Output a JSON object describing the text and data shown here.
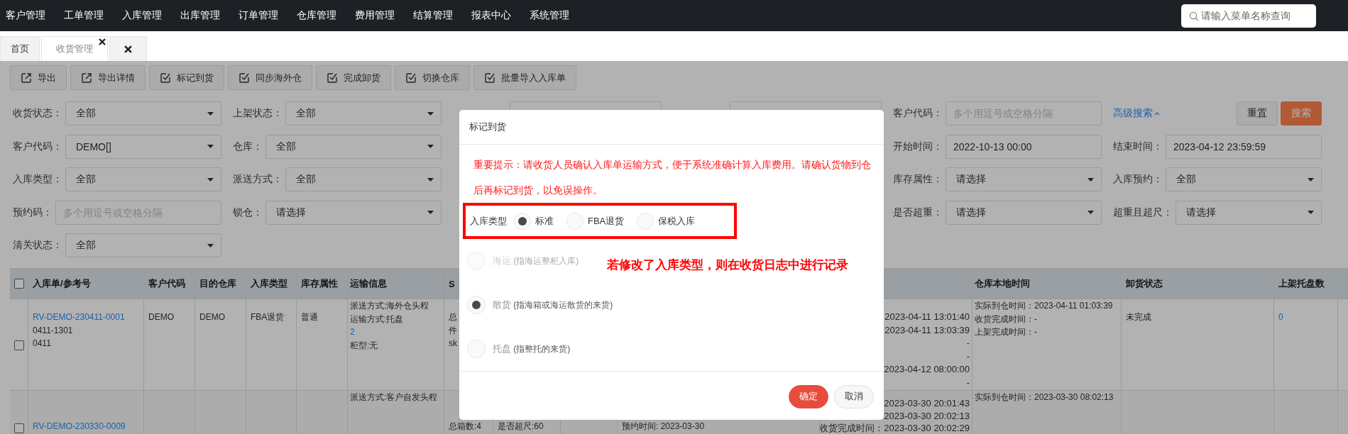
{
  "top_nav": {
    "menu": [
      "客户管理",
      "工单管理",
      "入库管理",
      "出库管理",
      "订单管理",
      "仓库管理",
      "费用管理",
      "结算管理",
      "报表中心",
      "系统管理"
    ],
    "search": {
      "placeholder": "请输入菜单名称查询"
    }
  },
  "tabs": [
    {
      "kind": "page",
      "label": "首页",
      "selected": false,
      "closable": false
    },
    {
      "kind": "page",
      "label": "收货管理",
      "selected": true,
      "closable": true
    },
    {
      "kind": "close-all",
      "selected": false
    }
  ],
  "toolbar": [
    {
      "label": "导出",
      "kind": "export"
    },
    {
      "label": "导出详情",
      "kind": "export"
    },
    {
      "label": "标记到货",
      "kind": "check"
    },
    {
      "label": "同步海外仓",
      "kind": "check"
    },
    {
      "label": "完成卸货",
      "kind": "check"
    },
    {
      "label": "切换仓库",
      "kind": "check"
    },
    {
      "label": "批量导入入库单",
      "kind": "check"
    }
  ],
  "filters": [
    [
      {
        "kind": "select",
        "label": "收货状态：",
        "value": "全部"
      },
      {
        "kind": "select",
        "label": "上架状态：",
        "value": "全部"
      },
      {
        "kind": "input"
      },
      {
        "kind": "input"
      },
      {
        "kind": "input",
        "label": "客户代码：",
        "placeholder": "多个用逗号或空格分隔"
      },
      {
        "kind": "actions",
        "link": "高级搜索",
        "buttons": [
          {
            "label": "重置",
            "kind": "default"
          },
          {
            "label": "搜索",
            "kind": "primary"
          }
        ]
      }
    ],
    [
      {
        "kind": "select",
        "label": "客户代码：",
        "value": "DEMO[]"
      },
      {
        "kind": "select",
        "label": "仓库：",
        "value": "全部"
      },
      {
        "kind": "covered"
      },
      {
        "kind": "covered"
      },
      {
        "kind": "input",
        "label": "开始时间：",
        "value": "2022-10-13 00:00"
      },
      {
        "kind": "input",
        "label": "结束时间：",
        "value": "2023-04-12 23:59:59"
      }
    ],
    [
      {
        "kind": "select",
        "label": "入库类型：",
        "value": "全部"
      },
      {
        "kind": "select",
        "label": "派送方式：",
        "value": "全部"
      },
      {
        "kind": "covered"
      },
      {
        "kind": "covered"
      },
      {
        "kind": "select",
        "label": "库存属性：",
        "value": "请选择"
      },
      {
        "kind": "select",
        "label": "入库预约：",
        "value": "全部"
      }
    ],
    [
      {
        "kind": "input",
        "label": "预约码：",
        "placeholder": "多个用逗号或空格分隔"
      },
      {
        "kind": "select",
        "label": "锁仓：",
        "value": "请选择"
      },
      {
        "kind": "covered"
      },
      {
        "kind": "covered"
      },
      {
        "kind": "select",
        "label": "是否超重：",
        "value": "请选择"
      },
      {
        "kind": "select",
        "label": "超重且超尺：",
        "value": "请选择"
      }
    ],
    [
      {
        "kind": "select",
        "label": "清关状态：",
        "value": "全部"
      }
    ]
  ],
  "table": {
    "select_all_checked": false,
    "columns": [
      {
        "header": "入库单/参考号"
      },
      {
        "header": "客户代码"
      },
      {
        "header": "目的仓库"
      },
      {
        "header": "入库类型"
      },
      {
        "header": "库存属性"
      },
      {
        "header": "运输信息"
      },
      {
        "header": "S"
      },
      {},
      {},
      {},
      {},
      {
        "header": "仓库本地时间"
      },
      {
        "header": "卸货状态"
      },
      {
        "header": "上架托盘数"
      }
    ],
    "rows": [
      {
        "checked": false,
        "cells": [
          [
            {
              "kind": "link",
              "text": "RV-DEMO-230411-0001"
            },
            {
              "kind": "text",
              "text": "0411-1301"
            },
            {
              "kind": "text",
              "text": "0411"
            }
          ],
          [
            {
              "kind": "text",
              "text": "DEMO"
            }
          ],
          [
            {
              "kind": "text",
              "text": "DEMO"
            }
          ],
          [
            {
              "kind": "text",
              "text": "FBA退货"
            }
          ],
          [
            {
              "kind": "text",
              "text": "普通"
            }
          ],
          [
            {
              "kind": "text",
              "text": "派送方式:海外仓头程"
            },
            {
              "kind": "text",
              "text": "运输方式:托盘"
            },
            {
              "kind": "link",
              "text": "2"
            },
            {
              "kind": "text",
              "text": "柜型:无"
            }
          ],
          [
            {
              "kind": "text",
              "text": "总"
            },
            {
              "kind": "text",
              "text": "件"
            },
            {
              "kind": "text",
              "text": "sk"
            }
          ],
          [],
          [],
          [],
          [
            {
              "kind": "text",
              "text": "2023-04-11 13:01:40"
            },
            {
              "kind": "text",
              "text": "2023-04-11 13:03:39"
            },
            {
              "kind": "text",
              "text": "-"
            },
            {
              "kind": "text",
              "text": "-"
            },
            {
              "kind": "text",
              "text": "2023-04-12 08:00:00"
            },
            {
              "kind": "text",
              "text": "-"
            }
          ],
          [
            {
              "kind": "text",
              "text": "实际到仓时间：2023-04-11 01:03:39"
            },
            {
              "kind": "text",
              "text": "收货完成时间：-"
            },
            {
              "kind": "text",
              "text": "上架完成时间：-"
            }
          ],
          [
            {
              "kind": "text",
              "text": "未完成"
            }
          ],
          [
            {
              "kind": "link",
              "text": "0"
            }
          ]
        ]
      },
      {
        "checked": false,
        "cells": [
          [
            {
              "kind": "link",
              "text": "RV-DEMO-230330-0009"
            }
          ],
          [],
          [],
          [],
          [],
          [
            {
              "kind": "text",
              "text": "派送方式:客户自发头程"
            }
          ],
          [
            {
              "kind": "text",
              "text": "总箱数:4"
            }
          ],
          [
            {
              "kind": "text",
              "text": "是否超尺:60"
            }
          ],
          [],
          [
            {
              "kind": "text",
              "text": "预约时间: 2023-03-30"
            }
          ],
          [
            {
              "kind": "text",
              "text": "2023-03-30 20:01:43"
            },
            {
              "kind": "text",
              "text": "2023-03-30 20:02:13"
            },
            {
              "kind": "text",
              "text": "收货完成时间：2023-03-30 20:02:29"
            }
          ],
          [
            {
              "kind": "text",
              "text": "实际到仓时间：2023-03-30 08:02:13"
            }
          ],
          [],
          []
        ]
      }
    ]
  },
  "modal": {
    "title": "标记到货",
    "notice": "重要提示：请收货人员确认入库单运输方式，便于系统准确计算入库费用。请确认货物到仓后再标记到货，以免误操作。",
    "inbound_type": {
      "label": "入库类型",
      "options": [
        {
          "label": "标准",
          "selected": true
        },
        {
          "label": "FBA退货",
          "selected": false
        },
        {
          "label": "保税入库",
          "selected": false
        }
      ]
    },
    "transport_options": [
      {
        "label": "海运",
        "note": "(指海运整柜入库)",
        "selected": false,
        "disabled": true
      },
      {
        "label": "散货",
        "note": "(指海箱或海运散货的来货)",
        "selected": true,
        "disabled": false
      },
      {
        "label": "托盘",
        "note": "(指整托的来货)",
        "selected": false,
        "disabled": false
      }
    ],
    "buttons": [
      {
        "label": "确定",
        "kind": "primary"
      },
      {
        "label": "取消",
        "kind": "default"
      }
    ]
  },
  "annotation": {
    "text": "若修改了入库类型，则在收货日志中进行记录"
  }
}
